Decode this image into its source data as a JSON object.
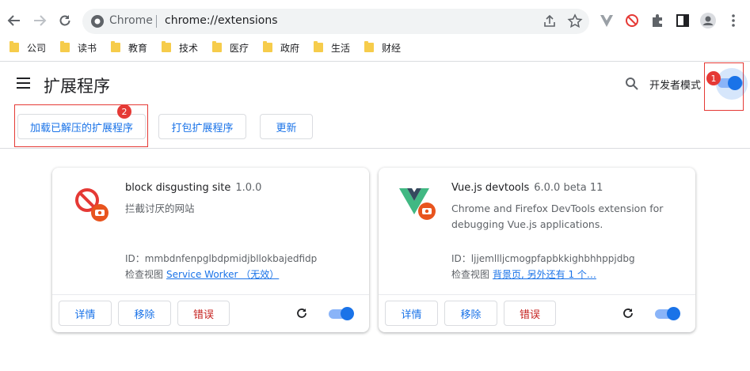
{
  "browser": {
    "omnibox_title": "Chrome",
    "omnibox_url": "chrome://extensions"
  },
  "bookmarks": [
    "公司",
    "读书",
    "教育",
    "技术",
    "医疗",
    "政府",
    "生活",
    "财经"
  ],
  "header": {
    "title": "扩展程序",
    "dev_mode_label": "开发者模式",
    "dev_mode_on": true,
    "badge1": "1",
    "badge2": "2"
  },
  "toolbar": {
    "load_unpacked": "加载已解压的扩展程序",
    "pack": "打包扩展程序",
    "update": "更新"
  },
  "extensions": [
    {
      "name": "block disgusting site",
      "version": "1.0.0",
      "description": "拦截讨厌的网站",
      "id_line": "ID：mmbdnfenpglbdpmidjbllokbajedfidp",
      "views_label": "检查视图",
      "views_link": "Service Worker （无效）",
      "details": "详情",
      "remove": "移除",
      "errors": "错误",
      "enabled": true
    },
    {
      "name": "Vue.js devtools",
      "version": "6.0.0 beta 11",
      "description": "Chrome and Firefox DevTools extension for debugging Vue.js applications.",
      "id_line": "ID：ljjemllljcmogpfapbkkighbhhppjdbg",
      "views_label": "检查视图",
      "views_link": "背景页, 另外还有 1 个…",
      "details": "详情",
      "remove": "移除",
      "errors": "错误",
      "enabled": true
    }
  ]
}
